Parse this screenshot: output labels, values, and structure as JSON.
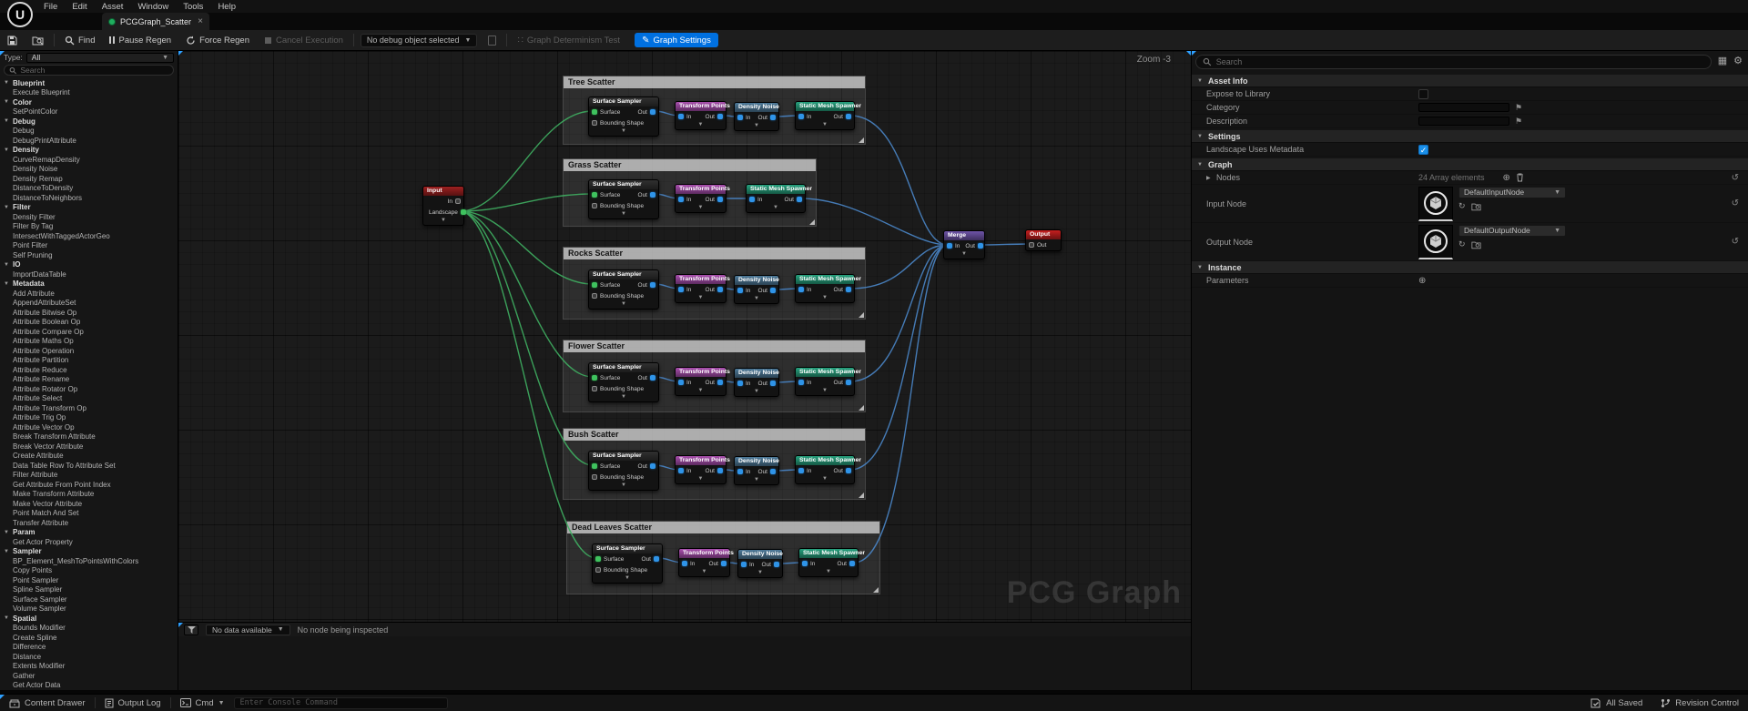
{
  "menu": {
    "items": [
      "File",
      "Edit",
      "Asset",
      "Window",
      "Tools",
      "Help"
    ]
  },
  "tab": {
    "title": "PCGGraph_Scatter"
  },
  "toolbar": {
    "find": "Find",
    "pause_regen": "Pause Regen",
    "force_regen": "Force Regen",
    "cancel_execution": "Cancel Execution",
    "debug_object": "No debug object selected",
    "determinism_test": "Graph Determinism Test",
    "graph_settings": "Graph Settings"
  },
  "palette": {
    "type_label": "Type:",
    "type_value": "All",
    "search_placeholder": "Search",
    "sections": [
      {
        "category": "Blueprint",
        "items": [
          "Execute Blueprint"
        ]
      },
      {
        "category": "Color",
        "items": [
          "SetPointColor"
        ]
      },
      {
        "category": "Debug",
        "items": [
          "Debug",
          "DebugPrintAttribute"
        ]
      },
      {
        "category": "Density",
        "items": [
          "CurveRemapDensity",
          "Density Noise",
          "Density Remap",
          "DistanceToDensity",
          "DistanceToNeighbors"
        ]
      },
      {
        "category": "Filter",
        "items": [
          "Density Filter",
          "Filter By Tag",
          "IntersectWithTaggedActorGeo",
          "Point Filter",
          "Self Pruning"
        ]
      },
      {
        "category": "IO",
        "items": [
          "ImportDataTable"
        ]
      },
      {
        "category": "Metadata",
        "items": [
          "Add Attribute",
          "AppendAttributeSet",
          "Attribute Bitwise Op",
          "Attribute Boolean Op",
          "Attribute Compare Op",
          "Attribute Maths Op",
          "Attribute Operation",
          "Attribute Partition",
          "Attribute Reduce",
          "Attribute Rename",
          "Attribute Rotator Op",
          "Attribute Select",
          "Attribute Transform Op",
          "Attribute Trig Op",
          "Attribute Vector Op",
          "Break Transform Attribute",
          "Break Vector Attribute",
          "Create Attribute",
          "Data Table Row To Attribute Set",
          "Filter Attribute",
          "Get Attribute From Point Index",
          "Make Transform Attribute",
          "Make Vector Attribute",
          "Point Match And Set",
          "Transfer Attribute"
        ]
      },
      {
        "category": "Param",
        "items": [
          "Get Actor Property"
        ]
      },
      {
        "category": "Sampler",
        "items": [
          "BP_Element_MeshToPointsWithColors",
          "Copy Points",
          "Point Sampler",
          "Spline Sampler",
          "Surface Sampler",
          "Volume Sampler"
        ]
      },
      {
        "category": "Spatial",
        "items": [
          "Bounds Modifier",
          "Create Spline",
          "Difference",
          "Distance",
          "Extents Modifier",
          "Gather",
          "Get Actor Data"
        ]
      }
    ]
  },
  "graph": {
    "zoom_label": "Zoom -3",
    "watermark": "PCG Graph",
    "input_node": {
      "title": "Input",
      "pin_in_label": "In",
      "pin_landscape_label": "Landscape"
    },
    "merge_node": {
      "title": "Merge",
      "in": "In",
      "out": "Out"
    },
    "output_node": {
      "title": "Output",
      "pin": "Out"
    },
    "node_defs": {
      "ss": {
        "title": "Surface Sampler",
        "pin_surface": "Surface",
        "pin_bounding": "Bounding Shape",
        "pin_out": "Out"
      },
      "tp": {
        "title": "Transform Points",
        "in": "In",
        "out": "Out"
      },
      "dn": {
        "title": "Density Noise",
        "in": "In",
        "out": "Out"
      },
      "sms": {
        "title": "Static Mesh Spawner",
        "in": "In",
        "out": "Out"
      }
    },
    "groups": [
      {
        "title": "Tree Scatter",
        "nodes": [
          "ss",
          "tp",
          "dn",
          "sms"
        ]
      },
      {
        "title": "Grass Scatter",
        "nodes": [
          "ss",
          "tp",
          "sms"
        ]
      },
      {
        "title": "Rocks Scatter",
        "nodes": [
          "ss",
          "tp",
          "dn",
          "sms"
        ]
      },
      {
        "title": "Flower Scatter",
        "nodes": [
          "ss",
          "tp",
          "dn",
          "sms"
        ]
      },
      {
        "title": "Bush Scatter",
        "nodes": [
          "ss",
          "tp",
          "dn",
          "sms"
        ]
      },
      {
        "title": "Dead Leaves Scatter",
        "nodes": [
          "ss",
          "tp",
          "dn",
          "sms"
        ]
      }
    ]
  },
  "details": {
    "search_placeholder": "Search",
    "asset_info": {
      "title": "Asset Info",
      "expose_label": "Expose to Library",
      "category_label": "Category",
      "description_label": "Description"
    },
    "settings": {
      "title": "Settings",
      "landscape_label": "Landscape Uses Metadata",
      "landscape_checked": true
    },
    "graph_section": {
      "title": "Graph",
      "nodes_label": "Nodes",
      "nodes_value": "24 Array elements",
      "input_node_label": "Input Node",
      "input_node_value": "DefaultInputNode",
      "output_node_label": "Output Node",
      "output_node_value": "DefaultOutputNode"
    },
    "instance": {
      "title": "Instance",
      "parameters_label": "Parameters"
    }
  },
  "inspector": {
    "data_dropdown": "No data available",
    "status": "No node being inspected"
  },
  "statusbar": {
    "content_drawer": "Content Drawer",
    "output_log": "Output Log",
    "cmd": "Cmd",
    "console_placeholder": "Enter Console Command",
    "all_saved": "All Saved",
    "revision_control": "Revision Control"
  },
  "colors": {
    "accent_blue": "#0070e0",
    "wire_blue": "#4a86c8",
    "wire_green": "#3faf62",
    "header_transform": "#a94fae",
    "header_density": "#4e7a99",
    "header_spawner": "#27a17e",
    "header_merge": "#6e54a8",
    "header_input": "#9e2020",
    "header_output": "#c51f1f"
  }
}
